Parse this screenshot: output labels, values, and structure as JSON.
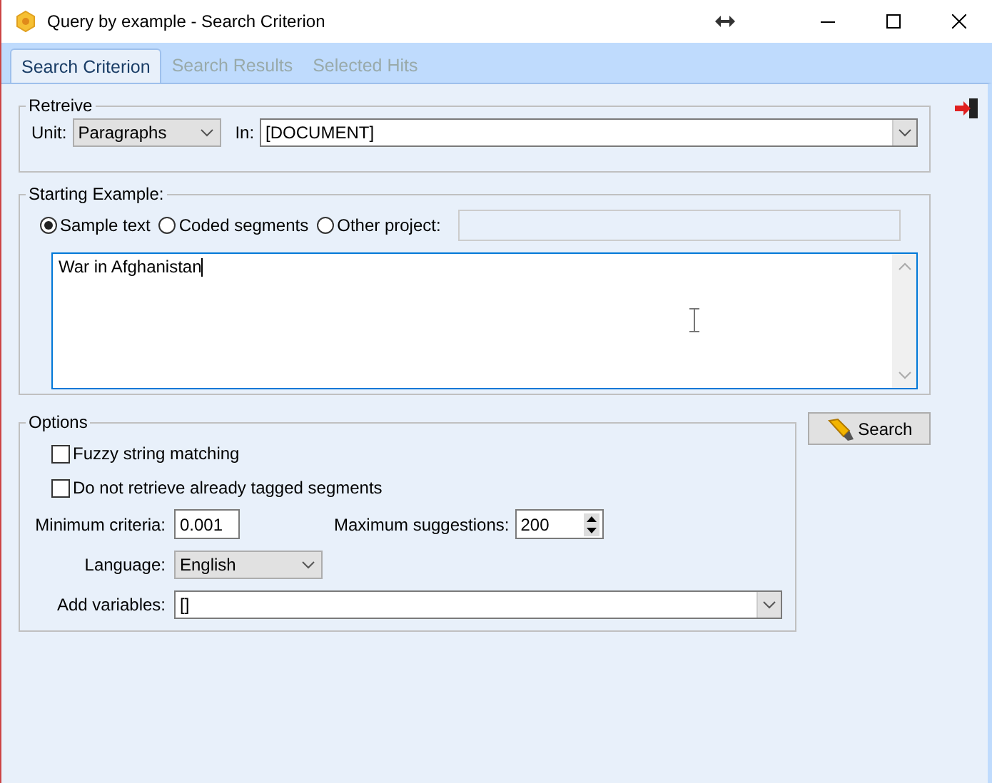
{
  "window": {
    "title": "Query by example - Search Criterion"
  },
  "tabs": [
    {
      "label": "Search Criterion",
      "selected": true
    },
    {
      "label": "Search Results",
      "selected": false
    },
    {
      "label": "Selected Hits",
      "selected": false
    }
  ],
  "retrieve": {
    "legend": "Retreive",
    "unit_label": "Unit:",
    "unit_value": "Paragraphs",
    "in_label": "In:",
    "in_value": "[DOCUMENT]"
  },
  "starting_example": {
    "legend": "Starting Example:",
    "options": [
      {
        "label": "Sample text",
        "selected": true
      },
      {
        "label": "Coded segments",
        "selected": false
      },
      {
        "label": "Other project:",
        "selected": false
      }
    ],
    "sample_text": "War in Afghanistan"
  },
  "options": {
    "legend": "Options",
    "checkboxes": [
      {
        "label": "Fuzzy string matching",
        "checked": false
      },
      {
        "label": "Do not retrieve already tagged segments",
        "checked": false
      }
    ],
    "min_label": "Minimum criteria:",
    "min_value": "0.001",
    "max_label": "Maximum suggestions:",
    "max_value": "200",
    "language_label": "Language:",
    "language_value": "English",
    "variables_label": "Add variables:",
    "variables_value": "[]"
  },
  "search_button": "Search"
}
